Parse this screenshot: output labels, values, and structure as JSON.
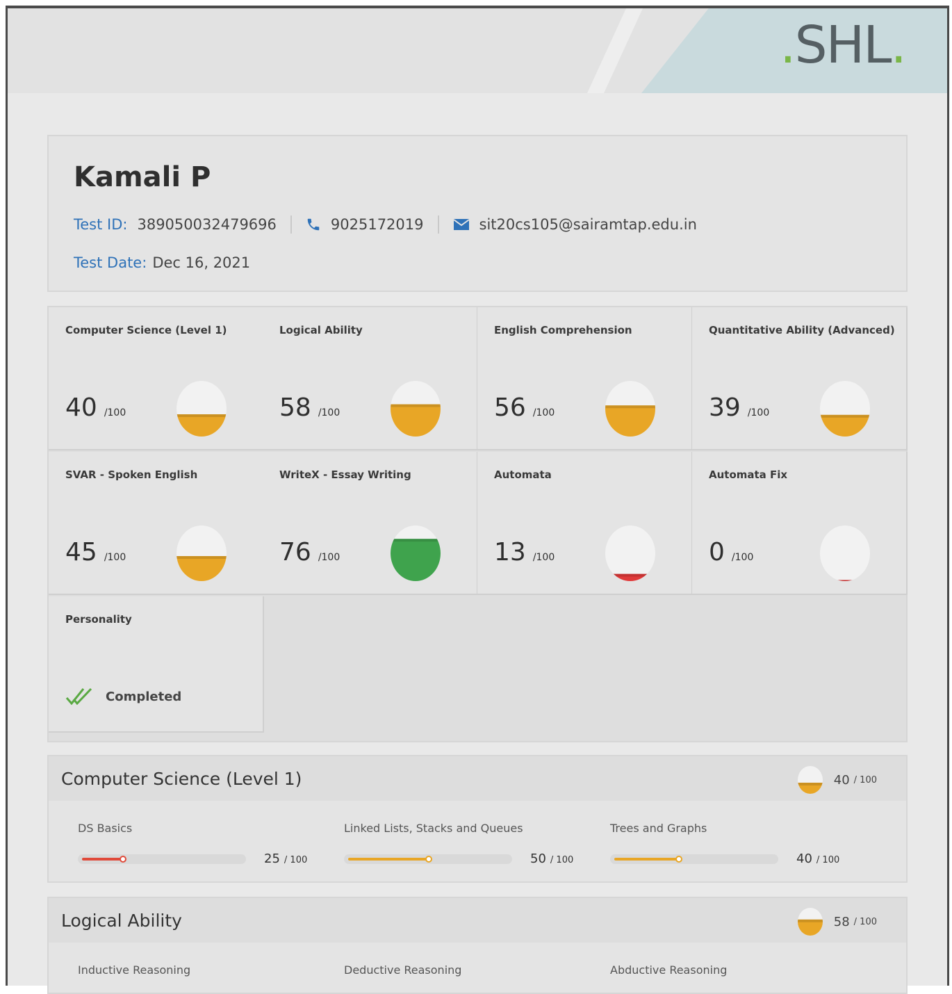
{
  "brand": {
    "logo_text": "SHL",
    "logo_dot": ".",
    "accent_green": "#7ab648",
    "accent_blue": "#2f72b8"
  },
  "candidate": {
    "name": "Kamali P",
    "test_id_label": "Test ID:",
    "test_id": "389050032479696",
    "phone": "9025172019",
    "email": "sit20cs105@sairamtap.edu.in",
    "test_date_label": "Test Date:",
    "test_date": "Dec 16, 2021"
  },
  "score_denominator": "/100",
  "tiles": [
    {
      "title": "Computer Science (Level 1)",
      "score": "40",
      "level": 0.4,
      "color": "#e8a626"
    },
    {
      "title": "Logical Ability",
      "score": "58",
      "level": 0.58,
      "color": "#e8a626"
    },
    {
      "title": "English Comprehension",
      "score": "56",
      "level": 0.56,
      "color": "#e8a626"
    },
    {
      "title": "Quantitative Ability (Advanced)",
      "score": "39",
      "level": 0.39,
      "color": "#e8a626"
    },
    {
      "title": "SVAR - Spoken English",
      "score": "45",
      "level": 0.45,
      "color": "#e8a626"
    },
    {
      "title": "WriteX - Essay Writing",
      "score": "76",
      "level": 0.76,
      "color": "#3fa34d"
    },
    {
      "title": "Automata",
      "score": "13",
      "level": 0.13,
      "color": "#e03a3a"
    },
    {
      "title": "Automata Fix",
      "score": "0",
      "level": 0.02,
      "color": "#e03a3a"
    }
  ],
  "personality": {
    "title": "Personality",
    "status": "Completed",
    "check_color": "#5aa943"
  },
  "sections": [
    {
      "title": "Computer Science (Level 1)",
      "score": "40",
      "denominator": "/ 100",
      "level": 0.4,
      "subsections": [
        {
          "label": "DS Basics",
          "score": "25",
          "denominator": "/ 100",
          "level": 0.25,
          "color": "#e04a3a"
        },
        {
          "label": "Linked Lists, Stacks and Queues",
          "score": "50",
          "denominator": "/ 100",
          "level": 0.5,
          "color": "#e8a626"
        },
        {
          "label": "Trees and Graphs",
          "score": "40",
          "denominator": "/ 100",
          "level": 0.4,
          "color": "#e8a626"
        }
      ]
    },
    {
      "title": "Logical Ability",
      "score": "58",
      "denominator": "/ 100",
      "level": 0.58,
      "subsections": [
        {
          "label": "Inductive Reasoning"
        },
        {
          "label": "Deductive Reasoning"
        },
        {
          "label": "Abductive Reasoning"
        }
      ]
    }
  ],
  "icons": {
    "phone": "phone-icon",
    "email": "envelope-icon",
    "check": "double-check-icon"
  }
}
